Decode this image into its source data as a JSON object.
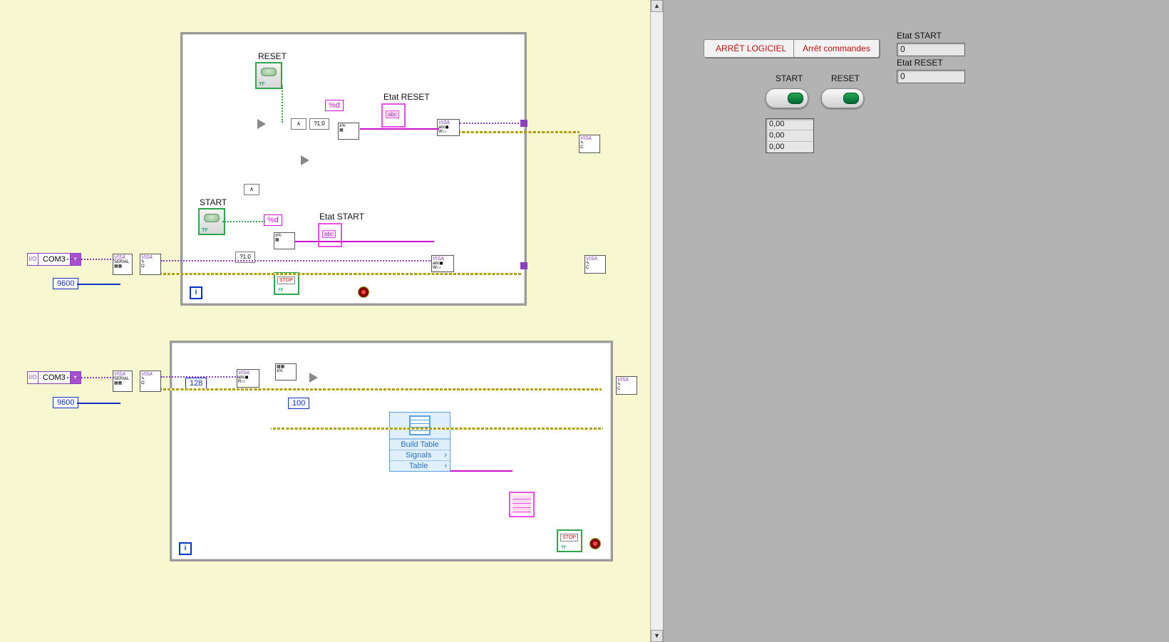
{
  "diagram": {
    "labels": {
      "reset": "RESET",
      "start": "START",
      "etat_reset": "Etat RESET",
      "etat_start": "Etat START",
      "fmt_d1": "%d",
      "fmt_d2": "%d"
    },
    "visa_resource": "COM3",
    "baud": "9600",
    "visa_resource_2": "COM3",
    "baud_2": "9600",
    "const_128": "128",
    "const_100": "100",
    "case_selector": "?1:0",
    "express": {
      "title": "Build Table",
      "row1": "Signals",
      "row2": "Table"
    }
  },
  "front_panel": {
    "btn_arret_logiciel": "ARRÊT LOGICIEL",
    "btn_arret_commandes": "Arrêt commandes",
    "lbl_start": "START",
    "lbl_reset": "RESET",
    "lbl_etat_start": "Etat START",
    "lbl_etat_reset": "Etat RESET",
    "val_etat_start": "0",
    "val_etat_reset": "0",
    "table_rows": [
      "0,00",
      "0,00",
      "0,00"
    ]
  }
}
